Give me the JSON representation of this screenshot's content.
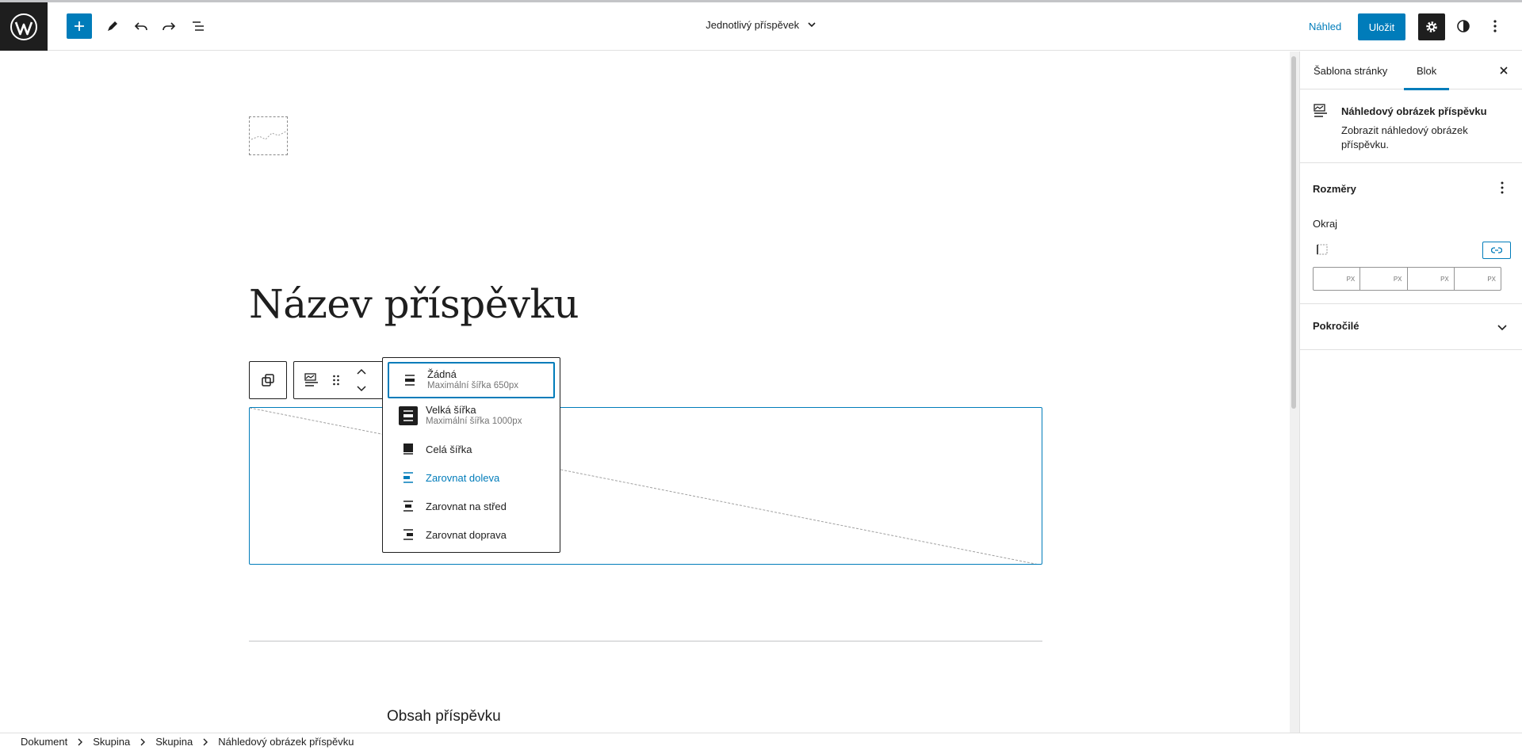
{
  "header": {
    "template_title": "Jednotlivý příspěvek",
    "preview_label": "Náhled",
    "save_label": "Uložit"
  },
  "canvas": {
    "post_title": "Název příspěvku",
    "post_content": "Obsah příspěvku"
  },
  "align_menu": {
    "items": [
      {
        "label": "Žádná",
        "sub": "Maximální šířka 650px"
      },
      {
        "label": "Velká šířka",
        "sub": "Maximální šířka 1000px"
      },
      {
        "label": "Celá šířka"
      },
      {
        "label": "Zarovnat doleva"
      },
      {
        "label": "Zarovnat na střed"
      },
      {
        "label": "Zarovnat doprava"
      }
    ]
  },
  "sidebar": {
    "tabs": [
      "Šablona stránky",
      "Blok"
    ],
    "active_tab": "Blok",
    "block_name": "Náhledový obrázek příspěvku",
    "block_desc": "Zobrazit náhledový obrázek příspěvku.",
    "dimensions_title": "Rozměry",
    "margin_label": "Okraj",
    "unit": "PX",
    "advanced_title": "Pokročilé"
  },
  "breadcrumbs": [
    "Dokument",
    "Skupina",
    "Skupina",
    "Náhledový obrázek příspěvku"
  ],
  "colors": {
    "accent": "#007cba",
    "dark": "#1e1e1e"
  }
}
